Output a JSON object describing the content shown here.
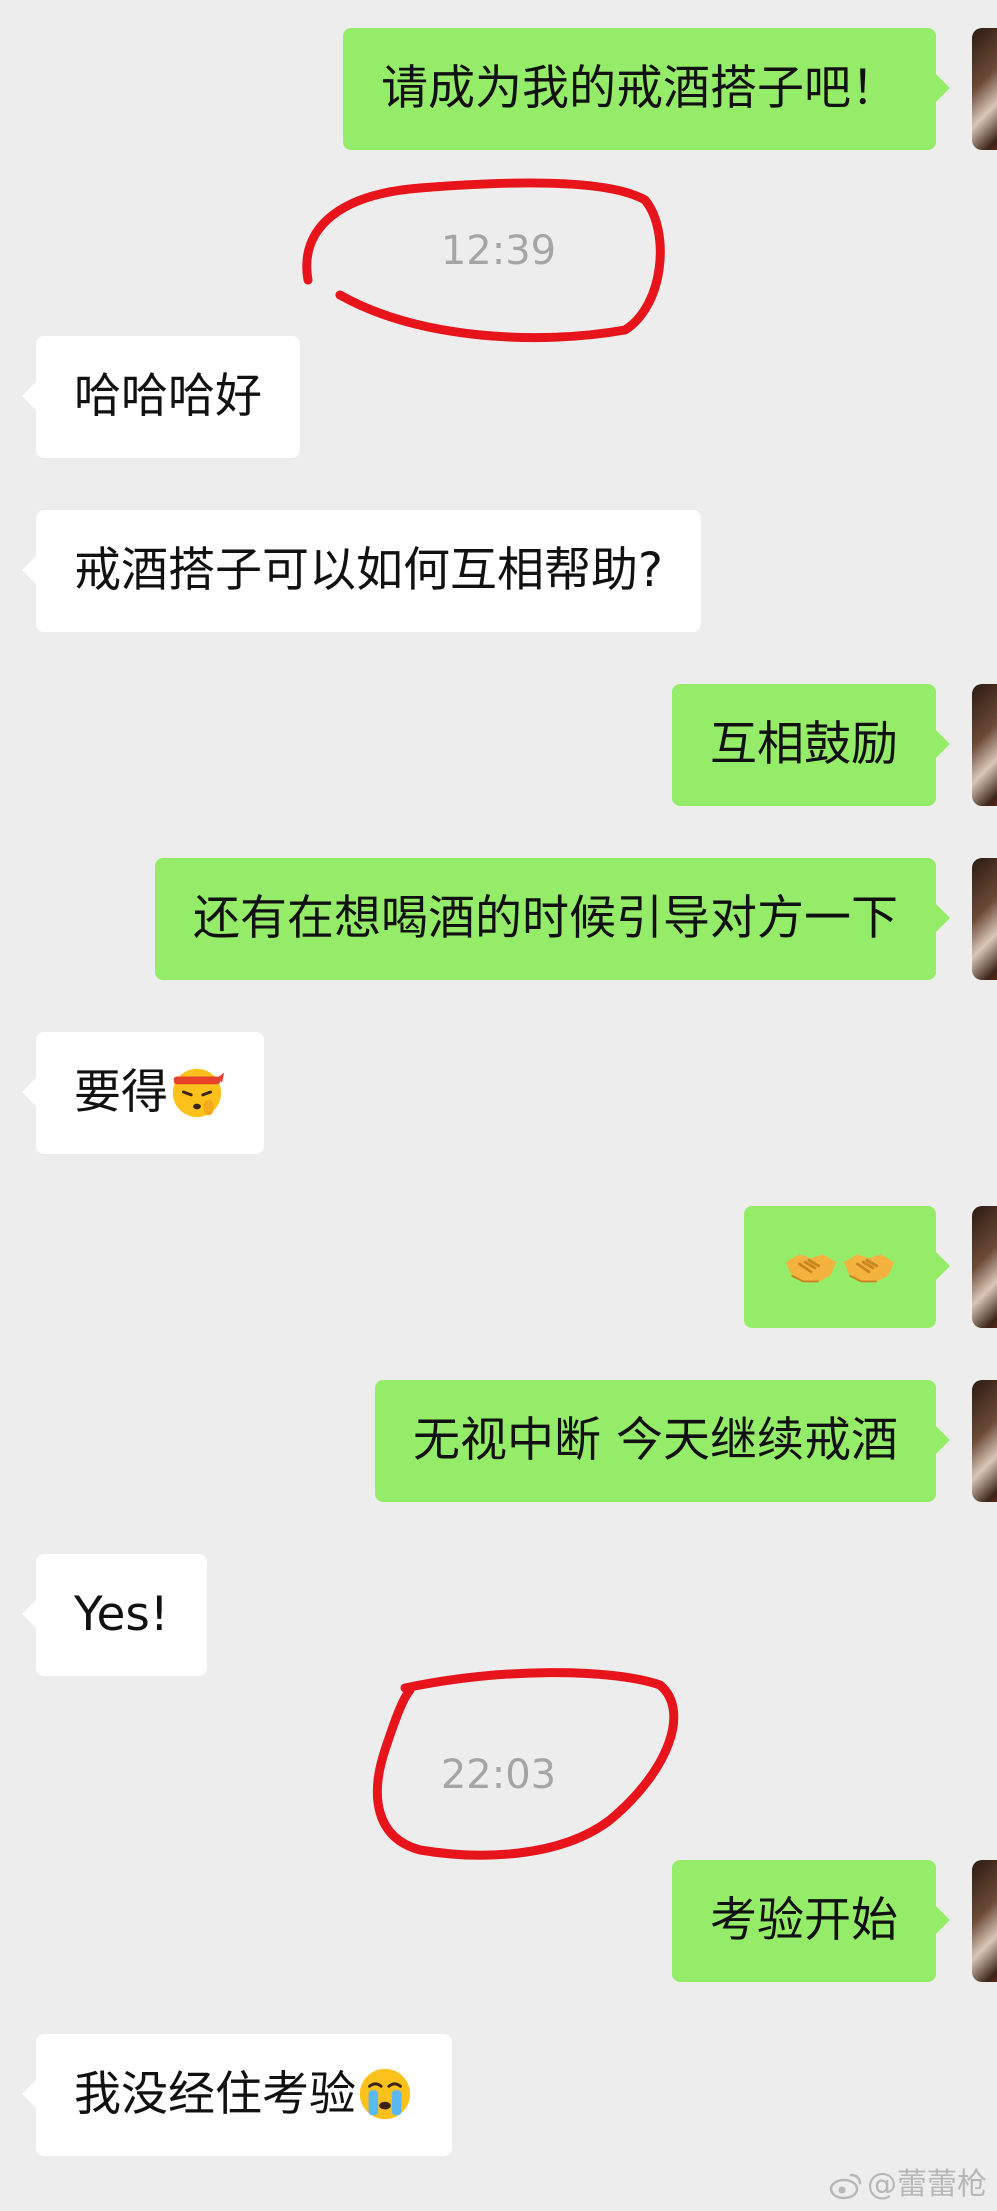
{
  "colors": {
    "background": "#EDEDED",
    "sent_bubble": "#95EC69",
    "received_bubble": "#FFFFFF",
    "timestamp_text": "#A5A5A5",
    "annotation_circle": "#E8141C"
  },
  "messages": {
    "m1": {
      "text": "请成为我的戒酒搭子吧！"
    },
    "t1": {
      "text": "12:39"
    },
    "m2": {
      "text": "哈哈哈好"
    },
    "m3": {
      "text": "戒酒搭子可以如何互相帮助?"
    },
    "m4": {
      "text": "互相鼓励"
    },
    "m5": {
      "text": "还有在想喝酒的时候引导对方一下"
    },
    "m6": {
      "text": "要得",
      "emoji": "saluting-headband-face-emoji"
    },
    "m7": {
      "emoji": "handshake-emoji-x2"
    },
    "m8": {
      "text": "无视中断 今天继续戒酒"
    },
    "m9": {
      "text": "Yes!"
    },
    "t2": {
      "text": "22:03"
    },
    "m10": {
      "text": "考验开始"
    },
    "m11": {
      "text": "我没经住考验",
      "emoji": "crying-face-emoji"
    }
  },
  "watermark": {
    "text": "@蕾蕾枪",
    "icon": "weibo-icon"
  }
}
